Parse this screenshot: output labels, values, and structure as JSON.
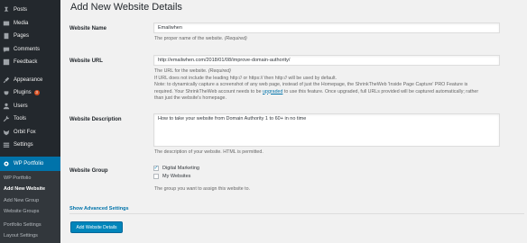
{
  "sidebar": {
    "items": [
      {
        "label": "Posts",
        "icon": "pin-icon"
      },
      {
        "label": "Media",
        "icon": "media-icon"
      },
      {
        "label": "Pages",
        "icon": "page-icon"
      },
      {
        "label": "Comments",
        "icon": "comment-icon"
      },
      {
        "label": "Feedback",
        "icon": "feedback-icon"
      },
      {
        "label": "Appearance",
        "icon": "brush-icon"
      },
      {
        "label": "Plugins",
        "icon": "plug-icon",
        "badge": "3"
      },
      {
        "label": "Users",
        "icon": "user-icon"
      },
      {
        "label": "Tools",
        "icon": "wrench-icon"
      },
      {
        "label": "Orbit Fox",
        "icon": "fox-icon"
      },
      {
        "label": "Settings",
        "icon": "settings-icon"
      },
      {
        "label": "WP Portfolio",
        "icon": "gear-icon"
      }
    ],
    "submenu": [
      "WP Portfolio",
      "Add New Website",
      "Add New Group",
      "Website Groups",
      "Portfolio Settings",
      "Layout Settings"
    ]
  },
  "page": {
    "title": "Add New Website Details",
    "website_name": {
      "label": "Website Name",
      "value": "Emailwhen",
      "help": "The proper name of the website.",
      "required": "(Required)"
    },
    "website_url": {
      "label": "Website URL",
      "value": "http://emailwhen.com/2018/01/08/improve-domain-authority/",
      "help_line1": "The URL for the website.",
      "required": "(Required)",
      "help_line2": "If URL does not include the leading http:// or https:// then http:// will be used by default.",
      "help_line3": "Note: to dynamically capture a screenshot of any web page, instead of just the Homepage, the ShrinkTheWeb 'Inside Page Capture' PRO Feature is",
      "help_line4_pre": "required. Your ShrinkTheWeb account needs to be ",
      "help_link": "upgraded",
      "help_line4_post": " to use this feature. Once upgraded, full URLs provided will be captured automatically; rather",
      "help_line5": "than just the website's homepage."
    },
    "website_description": {
      "label": "Website Description",
      "value": "How to take your website from Domain Authority 1 to 60+ in no time",
      "help": "The description of your website. HTML is permitted."
    },
    "website_group": {
      "label": "Website Group",
      "options": [
        {
          "label": "Digital Marketing",
          "checked": true
        },
        {
          "label": "My Websites",
          "checked": false
        }
      ],
      "help": "The group you want to assign this website to."
    },
    "advanced_link": "Show Advanced Settings",
    "submit_label": "Add Website Details"
  }
}
